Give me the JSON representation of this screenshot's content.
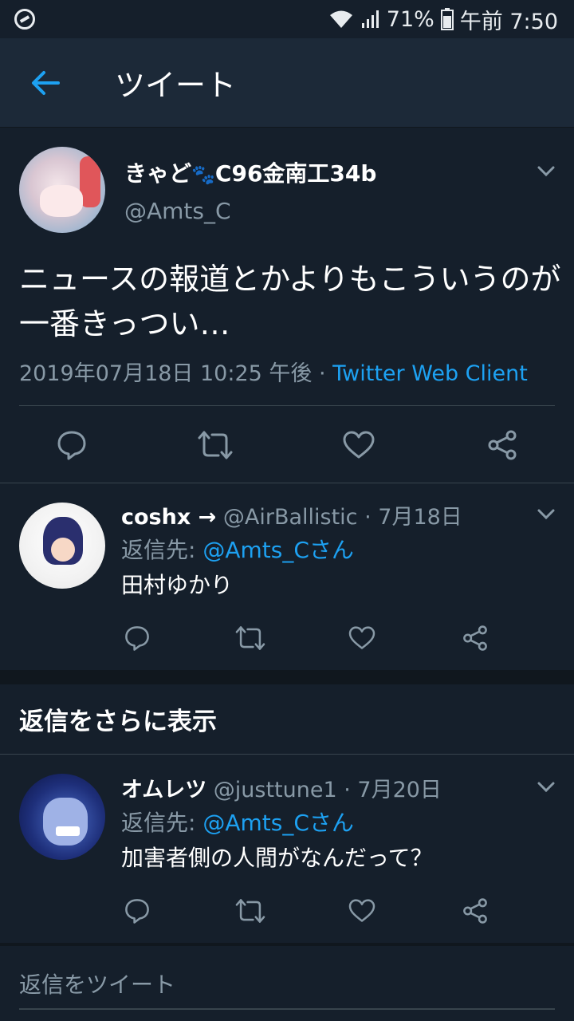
{
  "status_bar": {
    "battery": "71%",
    "time": "午前 7:50"
  },
  "header": {
    "title": "ツイート"
  },
  "main_tweet": {
    "display_name": "きゃど",
    "display_name_suffix": "C96金南工34b",
    "handle": "@Amts_C",
    "text": "ニュースの報道とかよりもこういうのが一番きっつい…",
    "timestamp": "2019年07月18日 10:25 午後 · ",
    "client": "Twitter Web Client"
  },
  "replies": [
    {
      "display_name": "coshx →",
      "sub": " @AirBallistic · 7月18日",
      "reply_to_label": "返信先: ",
      "reply_to_mention": "@Amts_Cさん",
      "text": "田村ゆかり"
    },
    {
      "display_name": "オムレツ",
      "sub": " @justtune1 · 7月20日",
      "reply_to_label": "返信先: ",
      "reply_to_mention": "@Amts_Cさん",
      "text": "加害者側の人間がなんだって？"
    }
  ],
  "more_replies_label": "返信をさらに表示",
  "compose": {
    "placeholder": "返信をツイート"
  },
  "icons": {
    "back": "arrow-left-icon",
    "caret": "chevron-down-icon",
    "reply": "reply-icon",
    "retweet": "retweet-icon",
    "like": "heart-icon",
    "share": "share-icon"
  },
  "colors": {
    "background": "#151f2b",
    "header": "#1c2938",
    "accent": "#1da1f2",
    "secondary_text": "#8899a6",
    "divider": "#38444d"
  }
}
